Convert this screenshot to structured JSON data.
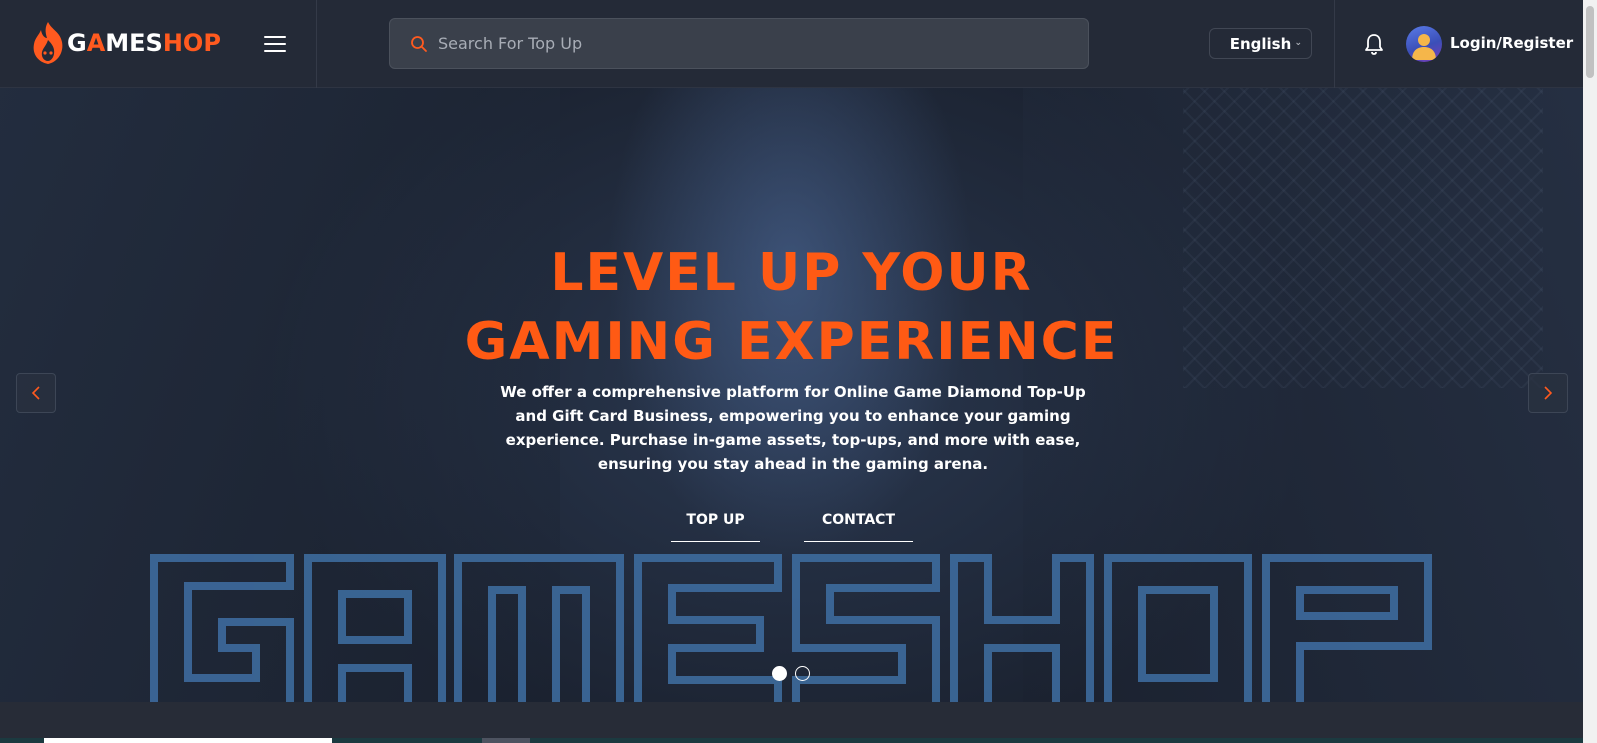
{
  "header": {
    "logo": {
      "part1": "G",
      "part2": "A",
      "part3": "MES",
      "part4": "HOP"
    },
    "menu_icon": "hamburger-icon",
    "search": {
      "placeholder": "Search For Top Up",
      "value": "",
      "icon": "search-icon"
    },
    "language": {
      "selected": "English",
      "icon": "chevron-down-icon"
    },
    "notification_icon": "bell-icon",
    "account": {
      "label": "Login/Register",
      "icon": "user-avatar-icon"
    }
  },
  "hero": {
    "title_line1": "LEVEL UP YOUR",
    "title_line2": "GAMING EXPERIENCE",
    "description": "We offer a comprehensive platform for Online Game Diamond Top-Up and Gift Card Business, empowering you to enhance your gaming experience. Purchase in-game assets, top-ups, and more with ease, ensuring you stay ahead in the gaming arena.",
    "buttons": {
      "top_up": "TOP UP",
      "contact": "CONTACT"
    },
    "background_wordmark": "GAMESHOP",
    "prev_icon": "chevron-left-icon",
    "next_icon": "chevron-right-icon",
    "slides": {
      "total": 2,
      "active": 1
    }
  },
  "colors": {
    "accent": "#ff5a14",
    "header_bg": "#242a37",
    "search_bg": "#3a404b",
    "page_bg": "#1f2430",
    "outline_blue": "#3f6fa3"
  }
}
